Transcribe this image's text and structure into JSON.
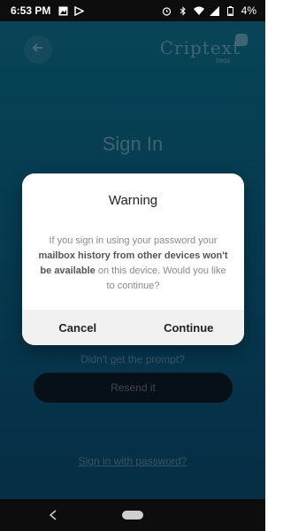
{
  "status_bar": {
    "time": "6:53 PM",
    "battery_percent": "4%",
    "icons": [
      "image-icon",
      "flag-icon",
      "alarm-icon",
      "bluetooth-icon",
      "wifi-icon",
      "signal-icon",
      "battery-icon"
    ]
  },
  "header": {
    "logo_text": "Criptext",
    "logo_sub": "beta"
  },
  "page": {
    "title": "Sign In",
    "prompt_link": "Didn't get the prompt?",
    "resend_button": "Resend it",
    "password_link": "Sign in with password?"
  },
  "dialog": {
    "title": "Warning",
    "body_parts": {
      "a": "If you sign in using your password your ",
      "b": "mailbox history from other devices won't be available",
      "c": " on this device. Would you like to continue?"
    },
    "cancel_label": "Cancel",
    "continue_label": "Continue"
  },
  "colors": {
    "background_top": "#0d6a86",
    "background_bottom": "#0a4468",
    "dialog_bg": "#ffffff",
    "actions_bg": "#f1f1f1"
  }
}
